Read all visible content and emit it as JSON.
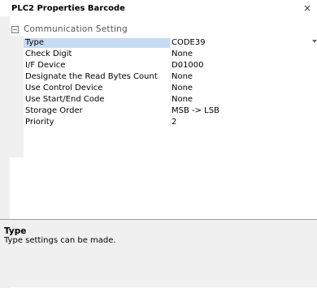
{
  "window": {
    "title": "PLC2 Properties Barcode",
    "close_glyph": "×"
  },
  "category": {
    "toggle_glyph": "⊟",
    "label": "Communication Setting"
  },
  "properties": [
    {
      "name": "Type",
      "value": "CODE39",
      "selected": true,
      "dropdown": true
    },
    {
      "name": "Check Digit",
      "value": "None"
    },
    {
      "name": "I/F Device",
      "value": "D01000"
    },
    {
      "name": "Designate the Read Bytes Count",
      "value": " None"
    },
    {
      "name": "Use Control Device",
      "value": " None"
    },
    {
      "name": "Use Start/End Code",
      "value": " None"
    },
    {
      "name": "Storage Order",
      "value": "MSB -> LSB"
    },
    {
      "name": "Priority",
      "value": "2"
    }
  ],
  "help": {
    "title": "Type",
    "description": "Type settings can be made."
  },
  "colors": {
    "selection": "#c4dcf3",
    "category_text": "#555555",
    "background": "#f0f0f0"
  }
}
